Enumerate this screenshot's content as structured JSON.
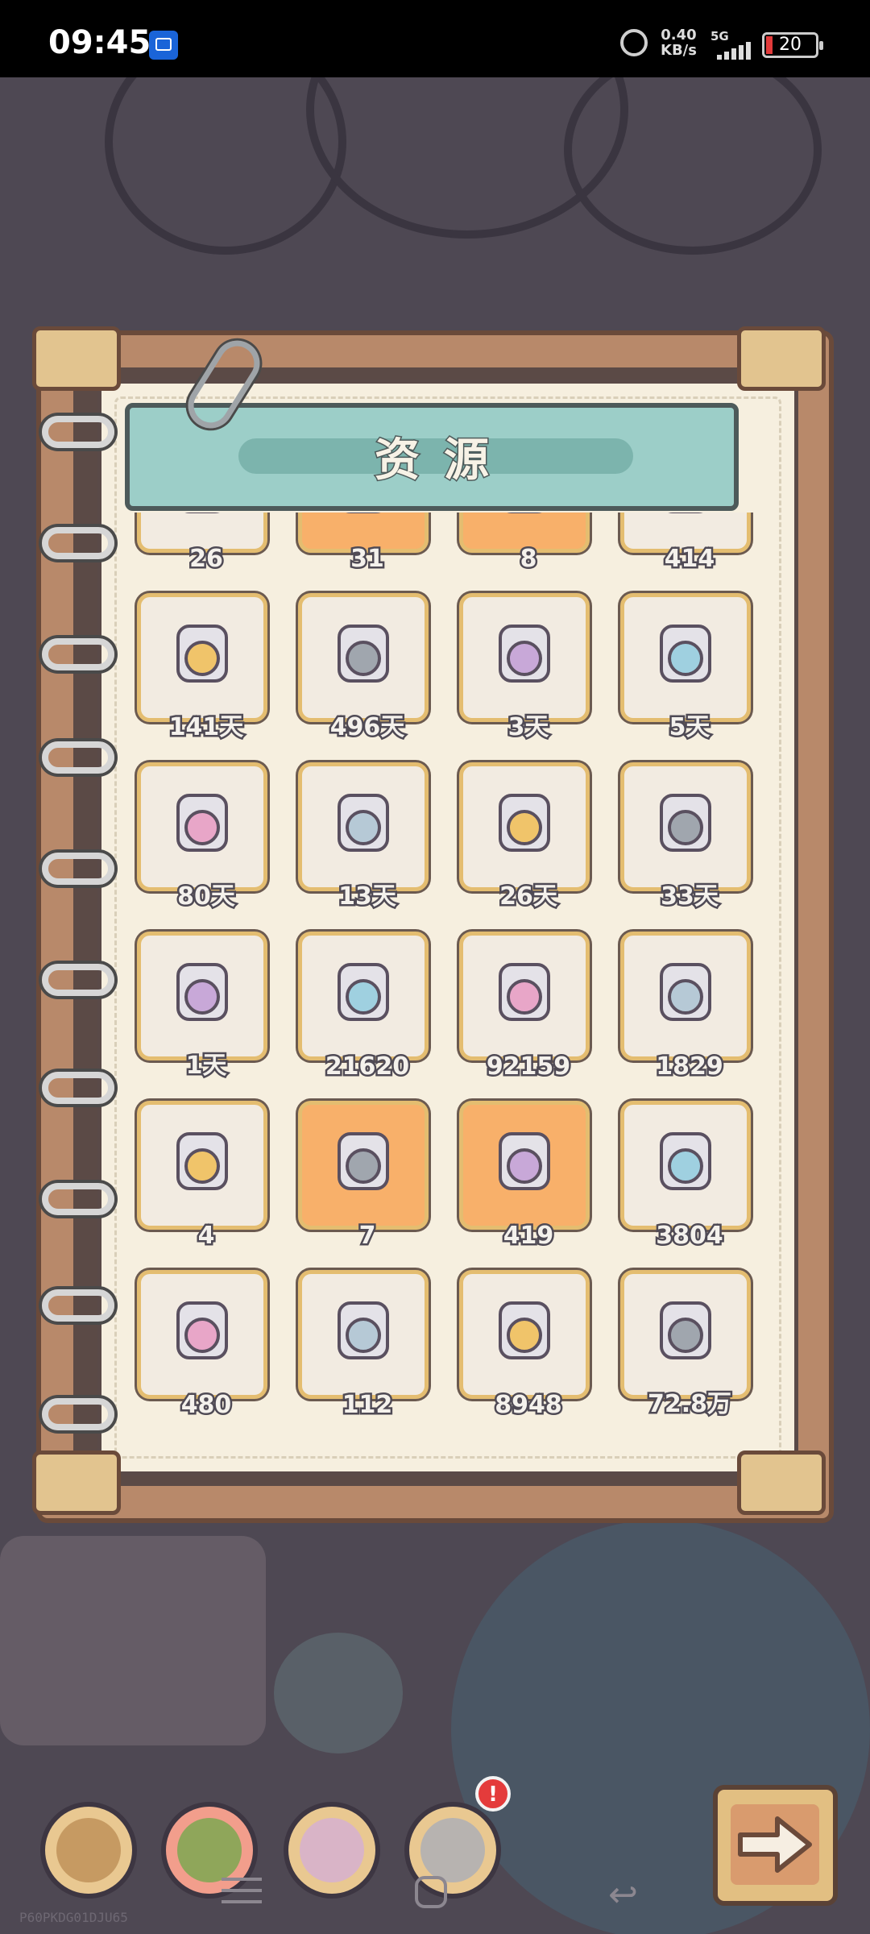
{
  "status_bar": {
    "time": "09:45",
    "speed_value": "0.40",
    "speed_unit": "KB/s",
    "network": "5G",
    "battery": "20"
  },
  "title": "资源",
  "colors": {
    "cell_bg": "#f2ebe1",
    "cell_border": "#e4bd70",
    "cell_highlight": "#f8b06a",
    "banner": "#9ccec8",
    "paper": "#f6efdf"
  },
  "resources": [
    {
      "icon": "shield-icon",
      "count": "26",
      "highlight": false
    },
    {
      "icon": "documents-icon",
      "count": "31",
      "highlight": true
    },
    {
      "icon": "gem-badge-icon",
      "count": "8",
      "highlight": true
    },
    {
      "icon": "crystal-badge-icon",
      "count": "414",
      "highlight": false
    },
    {
      "icon": "hourglass-icon",
      "count": "141天",
      "highlight": false
    },
    {
      "icon": "ghost-icon",
      "count": "496天",
      "highlight": false
    },
    {
      "icon": "medkit-icon",
      "count": "3天",
      "highlight": false
    },
    {
      "icon": "flask-icon",
      "count": "5天",
      "highlight": false
    },
    {
      "icon": "molecule-icon",
      "count": "80天",
      "highlight": false
    },
    {
      "icon": "slime-icon",
      "count": "13天",
      "highlight": false
    },
    {
      "icon": "funnel-icon",
      "count": "26天",
      "highlight": false
    },
    {
      "icon": "jerrycan-icon",
      "count": "33天",
      "highlight": false
    },
    {
      "icon": "cassette-icon",
      "count": "1天",
      "highlight": false
    },
    {
      "icon": "stamp-icon",
      "count": "21620",
      "highlight": false
    },
    {
      "icon": "ticket-icon",
      "count": "92159",
      "highlight": false
    },
    {
      "icon": "scroll-icon",
      "count": "1829",
      "highlight": false
    },
    {
      "icon": "star-icon",
      "count": "4",
      "highlight": false
    },
    {
      "icon": "clover-coin-icon",
      "count": "7",
      "highlight": true
    },
    {
      "icon": "gold-medal-icon",
      "count": "419",
      "highlight": true
    },
    {
      "icon": "blue-crystal-icon",
      "count": "3804",
      "highlight": false
    },
    {
      "icon": "pink-crystal-icon",
      "count": "480",
      "highlight": false
    },
    {
      "icon": "gold-bar-icon",
      "count": "112",
      "highlight": false
    },
    {
      "icon": "silver-coin-icon",
      "count": "8948",
      "highlight": false
    },
    {
      "icon": "rosette-icon",
      "count": "72.8万",
      "highlight": false
    }
  ],
  "bottom_bar": {
    "buttons": [
      "backpack-icon",
      "herb-icon",
      "gear-robot-icon",
      "chest-icon"
    ],
    "notification_badge": "!",
    "next_icon": "arrow-right-icon"
  },
  "device_code": "P60PKDG01DJU65"
}
